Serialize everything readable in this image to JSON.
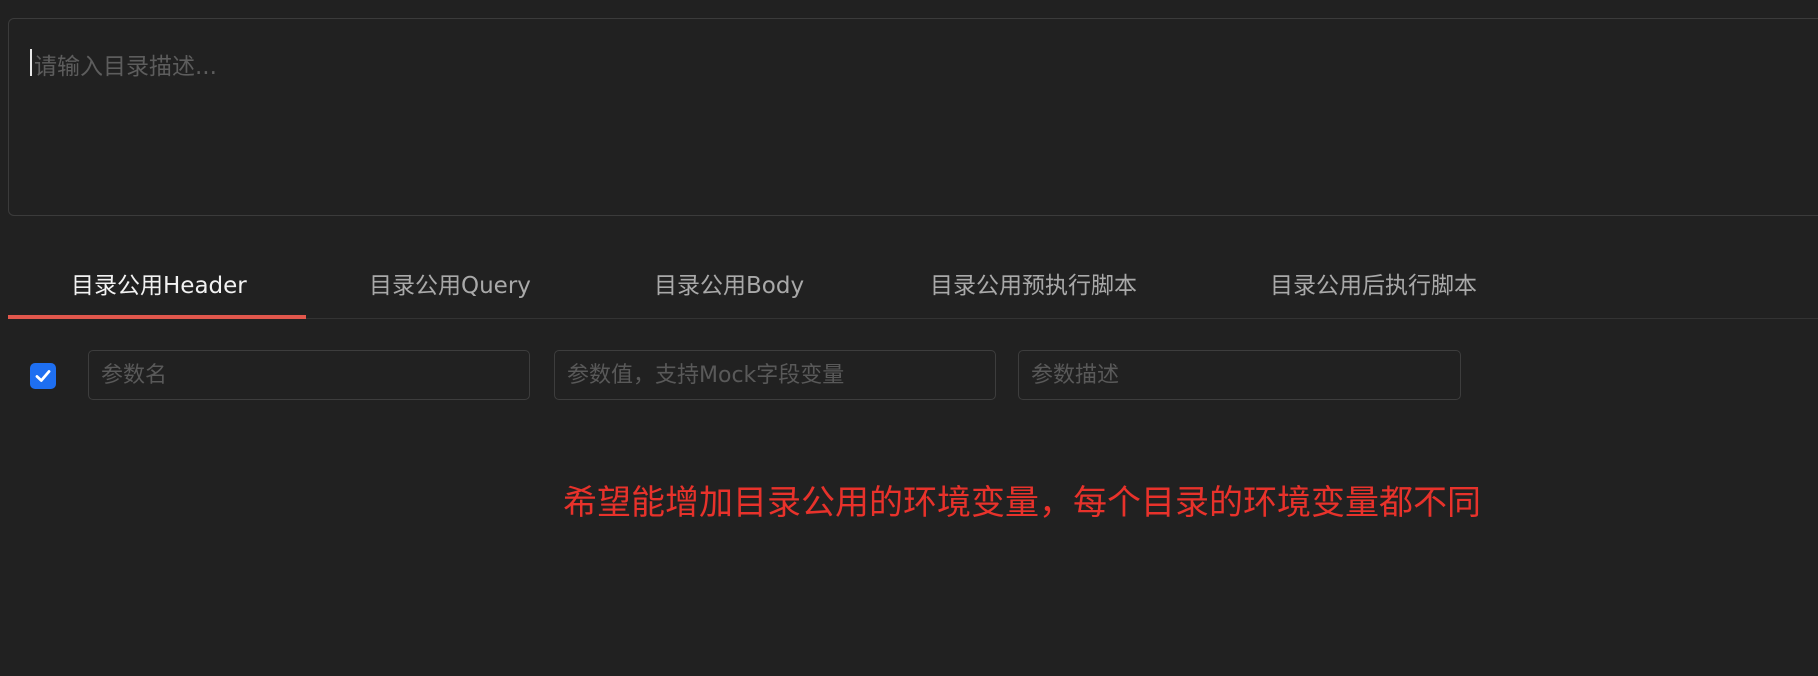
{
  "description": {
    "placeholder": "请输入目录描述..."
  },
  "tabs": [
    {
      "label": "目录公用Header",
      "active": true
    },
    {
      "label": "目录公用Query",
      "active": false
    },
    {
      "label": "目录公用Body",
      "active": false
    },
    {
      "label": "目录公用预执行脚本",
      "active": false
    },
    {
      "label": "目录公用后执行脚本",
      "active": false
    }
  ],
  "param_row": {
    "enabled": true,
    "name_placeholder": "参数名",
    "value_placeholder": "参数值，支持Mock字段变量",
    "desc_placeholder": "参数描述"
  },
  "annotation": {
    "text": "希望能增加目录公用的环境变量，每个目录的环境变量都不同",
    "color": "#e8322b"
  },
  "colors": {
    "background": "#212121",
    "tab_indicator": "#e2574c",
    "checkbox": "#1e6ff1"
  }
}
